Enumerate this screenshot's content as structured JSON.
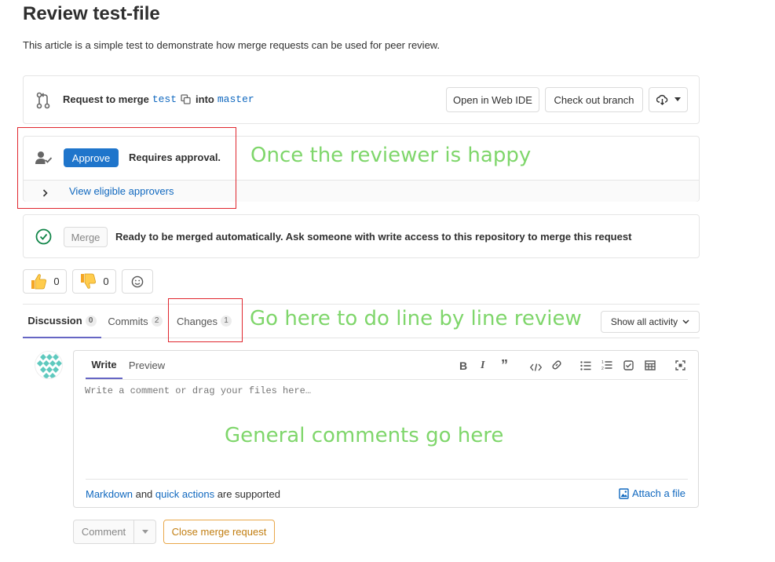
{
  "page": {
    "title": "Review test-file",
    "description": "This article is a simple test to demonstrate how merge requests can be used for peer review."
  },
  "merge_header": {
    "prefix": "Request to merge",
    "source_branch": "test",
    "into": "into",
    "target_branch": "master",
    "open_web_ide": "Open in Web IDE",
    "checkout_branch": "Check out branch"
  },
  "approval": {
    "approve_button": "Approve",
    "status": "Requires approval.",
    "view_approvers": "View eligible approvers",
    "annotation": "Once the reviewer is happy"
  },
  "merge_widget": {
    "merge_button": "Merge",
    "message": "Ready to be merged automatically. Ask someone with write access to this repository to merge this request"
  },
  "awards": {
    "thumbs_up_count": "0",
    "thumbs_down_count": "0"
  },
  "tabs": [
    {
      "label": "Discussion",
      "count": "0"
    },
    {
      "label": "Commits",
      "count": "2"
    },
    {
      "label": "Changes",
      "count": "1"
    }
  ],
  "tabs_annotation": "Go here to do line by line review",
  "activity_filter": "Show all activity",
  "comment_form": {
    "tab_write": "Write",
    "tab_preview": "Preview",
    "placeholder": "Write a comment or drag your files here…",
    "annotation": "General comments go here",
    "markdown_link": "Markdown",
    "and_text": "and",
    "quick_actions_link": "quick actions",
    "supported_text": "are supported",
    "attach_file": "Attach a file",
    "comment_button": "Comment",
    "close_button": "Close merge request"
  },
  "colors": {
    "accent_blue": "#1068bf",
    "approve_bg": "#1f75cb",
    "success_green": "#108548",
    "annotation_green": "#7fd66b",
    "annotation_red": "#e0262e",
    "close_orange": "#c17d10"
  }
}
